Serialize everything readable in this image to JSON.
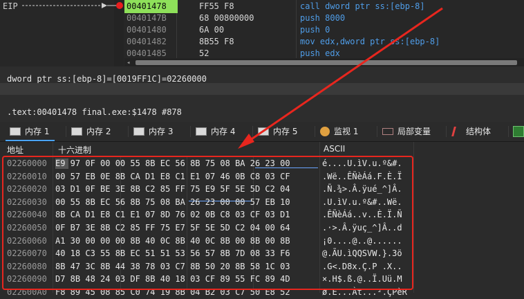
{
  "disasm": {
    "eip_label": "EIP",
    "lines": [
      {
        "addr": "00401478",
        "bytes": "FF55 F8",
        "mnemonic": "call",
        "operands": "dword ptr ss:[ebp-8]"
      },
      {
        "addr": "0040147B",
        "bytes": "68 00800000",
        "mnemonic": "push",
        "operands": "8000"
      },
      {
        "addr": "00401480",
        "bytes": "6A 00",
        "mnemonic": "push",
        "operands": "0"
      },
      {
        "addr": "00401482",
        "bytes": "8B55 F8",
        "mnemonic": "mov",
        "operands": "edx,dword ptr ss:[ebp-8]"
      },
      {
        "addr": "00401485",
        "bytes": "52",
        "mnemonic": "push",
        "operands": "edx"
      }
    ],
    "hscroll_left": "◂"
  },
  "info": {
    "line1": "dword ptr ss:[ebp-8]=[0019FF1C]=02260000",
    "line2": ".text:00401478 final.exe:$1478 #878"
  },
  "tabs": [
    {
      "label": "内存 1",
      "icon": "memory-icon",
      "active": true
    },
    {
      "label": "内存 2",
      "icon": "memory-icon"
    },
    {
      "label": "内存 3",
      "icon": "memory-icon"
    },
    {
      "label": "内存 4",
      "icon": "memory-icon"
    },
    {
      "label": "内存 5",
      "icon": "memory-icon"
    },
    {
      "label": "监视 1",
      "icon": "watch-icon"
    },
    {
      "label": "局部变量",
      "icon": "locals-icon"
    },
    {
      "label": "结构体",
      "icon": "struct-icon"
    }
  ],
  "dump": {
    "headers": {
      "address": "地址",
      "hex": "十六进制",
      "ascii": "ASCII"
    },
    "rows": [
      {
        "addr": "02260000",
        "hex": "E9 97 0F 00 00 55 8B EC 56 8B 75 08 BA 26 23 00",
        "ascii": "é....U.ìV.u.º&#."
      },
      {
        "addr": "02260010",
        "hex": "00 57 EB 0E 8B CA D1 E8 C1 E1 07 46 0B C8 03 CF",
        "ascii": ".Wë..ÊÑèÁá.F.È.Ï"
      },
      {
        "addr": "02260020",
        "hex": "03 D1 0F BE 3E 8B C2 85 FF 75 E9 5F 5E 5D C2 04",
        "ascii": ".Ñ.¾>.Â.ÿué_^]Â."
      },
      {
        "addr": "02260030",
        "hex": "00 55 8B EC 56 8B 75 08 BA 26 23 00 00 57 EB 10",
        "ascii": ".U.ìV.u.º&#..Wë."
      },
      {
        "addr": "02260040",
        "hex": "8B CA D1 E8 C1 E1 07 8D 76 02 0B C8 03 CF 03 D1",
        "ascii": ".ÊÑèÁá..v..È.Ï.Ñ"
      },
      {
        "addr": "02260050",
        "hex": "0F B7 3E 8B C2 85 FF 75 E7 5F 5E 5D C2 04 00 64",
        "ascii": ".·>.Â.ÿuç_^]Â..d"
      },
      {
        "addr": "02260060",
        "hex": "A1 30 00 00 00 8B 40 0C 8B 40 0C 8B 00 8B 00 8B",
        "ascii": "¡0....@..@......"
      },
      {
        "addr": "02260070",
        "hex": "40 18 C3 55 8B EC 51 51 53 56 57 8B 7D 08 33 F6",
        "ascii": "@.ÃU.ìQQSVW.}.3ö"
      },
      {
        "addr": "02260080",
        "hex": "8B 47 3C 8B 44 38 78 03 C7 8B 50 20 8B 58 1C 03",
        "ascii": ".G<.D8x.Ç.P .X.."
      },
      {
        "addr": "02260090",
        "hex": "D7 8B 48 24 03 DF 8B 40 18 03 CF 89 55 FC 89 4D",
        "ascii": "×.H$.ß.@..Ï.Uü.M"
      },
      {
        "addr": "022600A0",
        "hex": "F8 89 45 08 85 C0 74 19 8B 04 B2 03 C7 50 E8 52",
        "ascii": "ø.E...Àt...².ÇPèR"
      }
    ]
  }
}
